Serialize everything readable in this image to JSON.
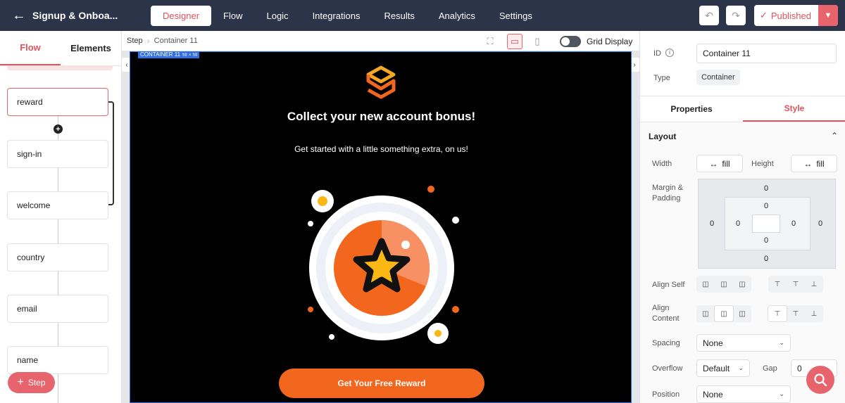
{
  "header": {
    "title": "Signup & Onboa...",
    "tabs": [
      {
        "label": "Designer",
        "active": true
      },
      {
        "label": "Flow"
      },
      {
        "label": "Logic"
      },
      {
        "label": "Integrations"
      },
      {
        "label": "Results"
      },
      {
        "label": "Analytics"
      },
      {
        "label": "Settings"
      }
    ],
    "published_label": "Published",
    "undo_icon": "undo-icon",
    "redo_icon": "redo-icon"
  },
  "left": {
    "tabs": [
      {
        "label": "Flow",
        "active": true
      },
      {
        "label": "Elements"
      }
    ],
    "steps": [
      "reward",
      "sign-in",
      "welcome",
      "country",
      "email",
      "name"
    ],
    "selected_step": "reward",
    "add_step_label": "Step"
  },
  "canvas": {
    "breadcrumb_step": "Step",
    "breadcrumb_current": "Container 11",
    "grid_display_label": "Grid Display",
    "container_tag": "CONTAINER 11",
    "container_tag_sub": "fill × fill",
    "headline": "Collect your new account bonus!",
    "subline": "Get started with a little something extra, on us!",
    "cta_label": "Get Your Free Reward"
  },
  "right": {
    "id_label": "ID",
    "id_value": "Container 11",
    "type_label": "Type",
    "type_value": "Container",
    "tabs": [
      {
        "label": "Properties"
      },
      {
        "label": "Style",
        "active": true
      }
    ],
    "layout_label": "Layout",
    "width_label": "Width",
    "width_value": "fill",
    "height_label": "Height",
    "height_value": "fill",
    "margin_label": "Margin &",
    "padding_label": "Padding",
    "margin": {
      "top": "0",
      "right": "0",
      "bottom": "0",
      "left": "0"
    },
    "padding": {
      "top": "0",
      "right": "0",
      "bottom": "0",
      "left": "0"
    },
    "align_self_label": "Align Self",
    "align_content_label": "Align",
    "align_content_label2": "Content",
    "spacing_label": "Spacing",
    "spacing_value": "None",
    "overflow_label": "Overflow",
    "overflow_value": "Default",
    "gap_label": "Gap",
    "gap_value": "0",
    "position_label": "Position",
    "position_value": "None"
  },
  "colors": {
    "accent": "#e8646c",
    "topbar": "#2c3449",
    "cta": "#f3661e",
    "star": "#fbb814"
  }
}
